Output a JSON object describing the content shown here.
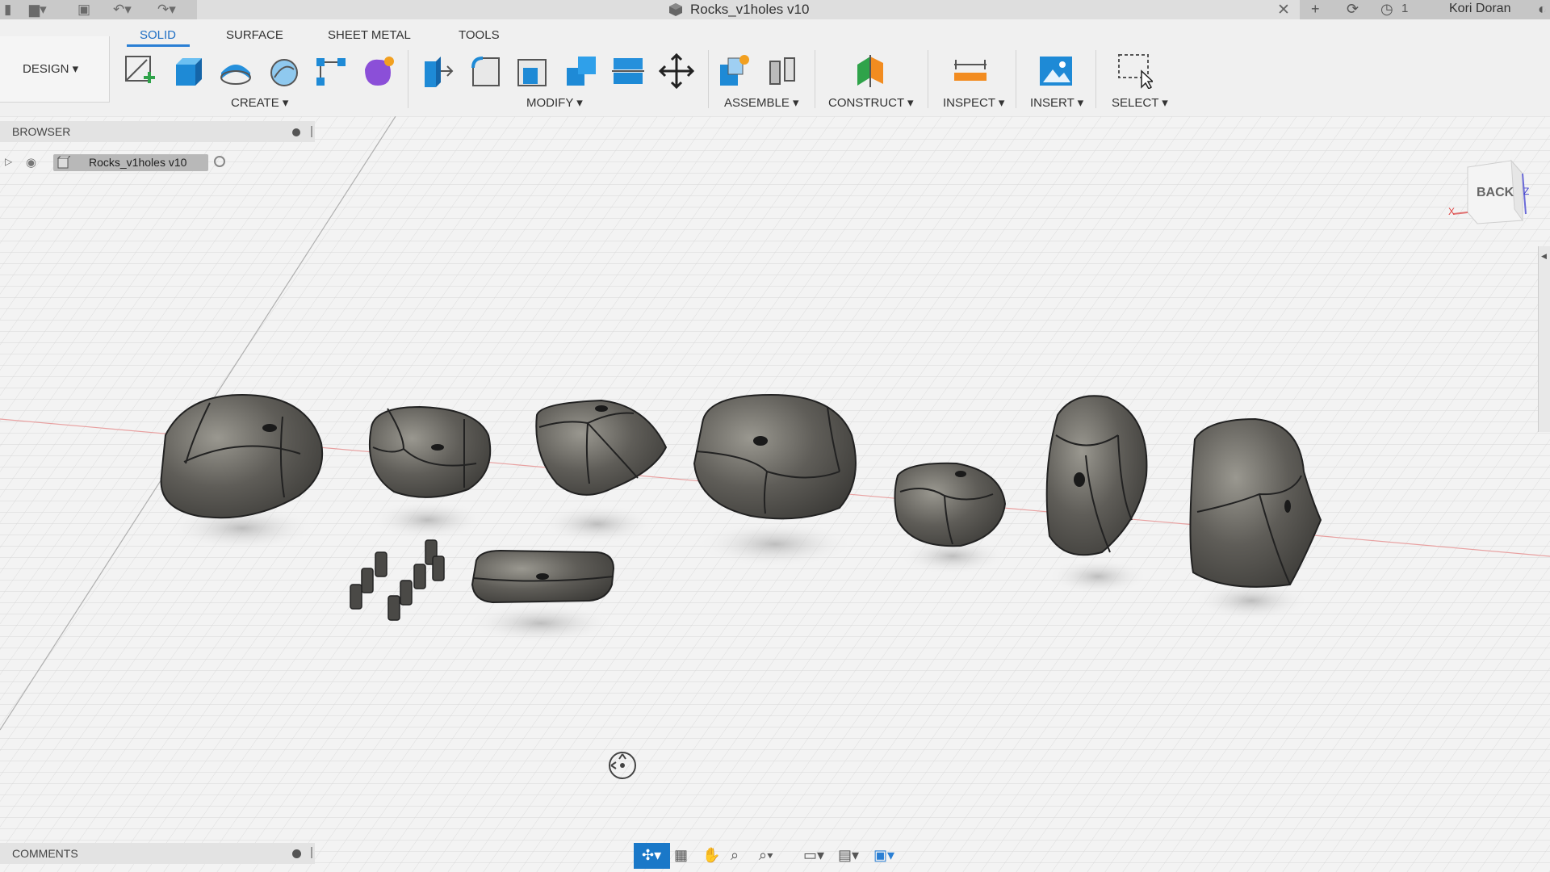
{
  "window": {
    "title": "Rocks_v1holes v10",
    "user_name": "Kori Doran",
    "job_count": "1"
  },
  "workspace": {
    "label": "DESIGN"
  },
  "tabs": [
    {
      "label": "SOLID",
      "active": true
    },
    {
      "label": "SURFACE"
    },
    {
      "label": "SHEET METAL"
    },
    {
      "label": "TOOLS"
    }
  ],
  "groups": {
    "create": "CREATE",
    "modify": "MODIFY",
    "assemble": "ASSEMBLE",
    "construct": "CONSTRUCT",
    "inspect": "INSPECT",
    "insert": "INSERT",
    "select": "SELECT"
  },
  "browser": {
    "label": "BROWSER",
    "items": [
      {
        "label": "Rocks_v1holes v10"
      }
    ]
  },
  "comments": {
    "label": "COMMENTS"
  },
  "viewcube": {
    "face": "BACK",
    "axis_x": "X",
    "axis_z": "Z"
  },
  "colors": {
    "accent": "#1f6fc4",
    "background": "#f3f3f3",
    "model": "#5a5954"
  },
  "icons": [
    "undo-icon",
    "redo-icon",
    "save-icon",
    "file-icon",
    "close-icon",
    "plus-icon",
    "sync-icon",
    "clock-icon",
    "sketch-icon",
    "extrude-icon",
    "revolve-icon",
    "sweep-icon",
    "pattern-icon",
    "form-icon",
    "press-pull-icon",
    "fillet-icon",
    "shell-icon",
    "combine-icon",
    "split-icon",
    "move-icon",
    "new-component-icon",
    "joint-icon",
    "plane-icon",
    "measure-icon",
    "insert-image-icon",
    "select-window-icon",
    "orbit-icon",
    "pan-icon",
    "zoom-icon",
    "display-icon",
    "grid-icon",
    "viewports-icon"
  ]
}
